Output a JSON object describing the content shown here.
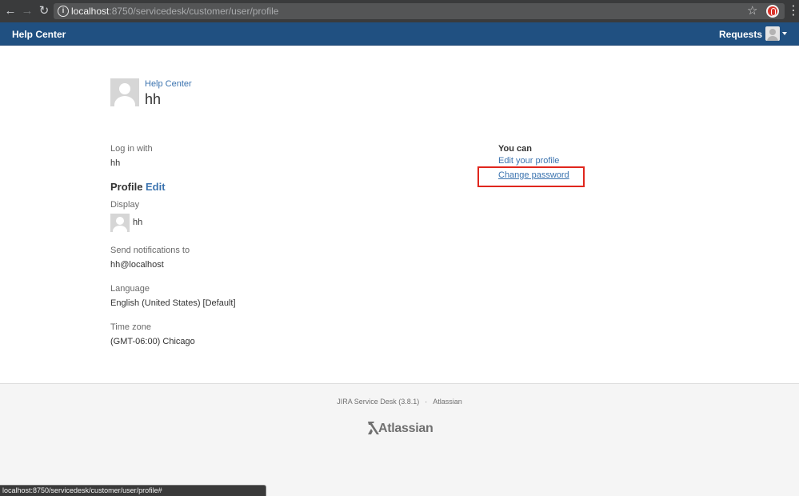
{
  "browser": {
    "url_host": "localhost",
    "url_rest": ":8750/servicedesk/customer/user/profile"
  },
  "header": {
    "logo": "Help Center",
    "requests": "Requests"
  },
  "profile_header": {
    "breadcrumb": "Help Center",
    "title": "hh"
  },
  "details": {
    "login_label": "Log in with",
    "login_value": "hh",
    "profile_heading": "Profile",
    "edit_link": "Edit",
    "display_label": "Display",
    "display_value": "hh",
    "notifications_label": "Send notifications to",
    "notifications_value": "hh@localhost",
    "language_label": "Language",
    "language_value": "English (United States) [Default]",
    "timezone_label": "Time zone",
    "timezone_value": "(GMT-06:00) Chicago"
  },
  "actions": {
    "heading": "You can",
    "edit_profile": "Edit your profile",
    "change_password": "Change password"
  },
  "footer": {
    "product": "JIRA Service Desk (3.8.1)",
    "separator": "·",
    "company": "Atlassian",
    "logo_text": "Atlassian"
  },
  "status_bar": {
    "text": "localhost:8750/servicedesk/customer/user/profile#"
  },
  "colors": {
    "header_bg": "#205081",
    "link": "#3b73af",
    "highlight": "#e0261d"
  }
}
